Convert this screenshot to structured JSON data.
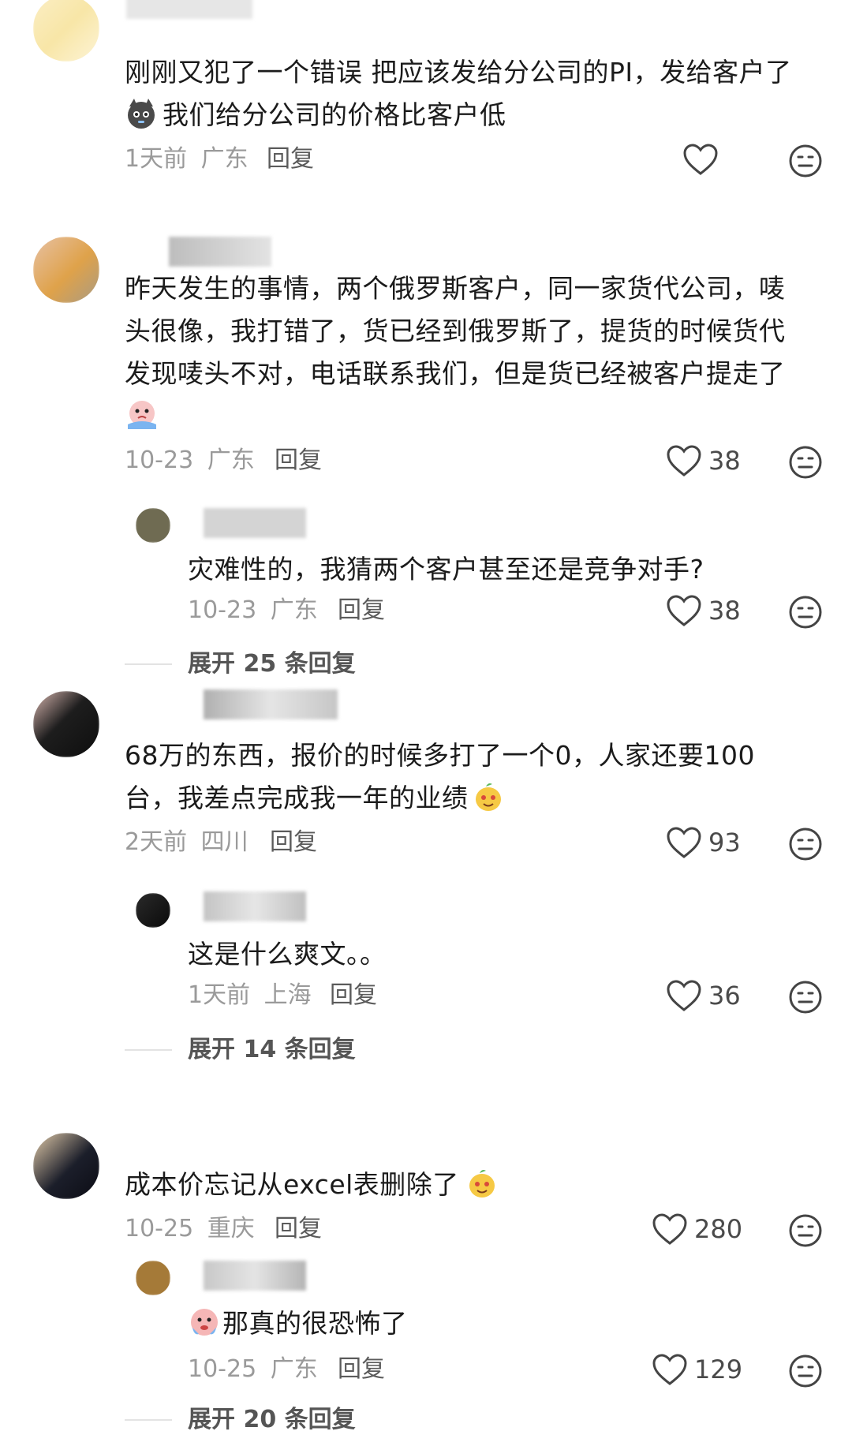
{
  "comments": [
    {
      "lines": [
        "刚刚又犯了一个错误 把应该发给分公司的PI，发给客户了",
        "我们给分公司的价格比客户低"
      ],
      "date": "1天前",
      "location": "广东",
      "reply_label": "回复",
      "likes": ""
    },
    {
      "lines": [
        "昨天发生的事情，两个俄罗斯客户，同一家货代公司，唛",
        "头很像，我打错了，货已经到俄罗斯了，提货的时候货代",
        "发现唛头不对，电话联系我们，但是货已经被客户提走了"
      ],
      "date": "10-23",
      "location": "广东",
      "reply_label": "回复",
      "likes": "38",
      "replies": [
        {
          "text": "灾难性的，我猜两个客户甚至还是竞争对手?",
          "date": "10-23",
          "location": "广东",
          "reply_label": "回复",
          "likes": "38"
        }
      ],
      "expand": "展开 25 条回复"
    },
    {
      "lines": [
        "68万的东西，报价的时候多打了一个0，人家还要100",
        "台，我差点完成我一年的业绩"
      ],
      "date": "2天前",
      "location": "四川",
      "reply_label": "回复",
      "likes": "93",
      "replies": [
        {
          "text": "这是什么爽文。。",
          "date": "1天前",
          "location": "上海",
          "reply_label": "回复",
          "likes": "36"
        }
      ],
      "expand": "展开 14 条回复"
    },
    {
      "lines": [
        "成本价忘记从excel表删除了"
      ],
      "date": "10-25",
      "location": "重庆",
      "reply_label": "回复",
      "likes": "280",
      "replies": [
        {
          "text": "那真的很恐怖了",
          "date": "10-25",
          "location": "广东",
          "reply_label": "回复",
          "likes": "129"
        }
      ],
      "expand": "展开 20 条回复"
    }
  ],
  "icons": {
    "like": "heart-outline-icon",
    "dislike": "neutral-face-icon",
    "cat_emoji": "cat-face-emoji",
    "crying_emoji": "crying-face-emoji",
    "mango_emoji": "mango-smile-emoji"
  },
  "colors": {
    "text": "#1b1b1b",
    "meta": "#9a9a9a",
    "reply": "#5b5b5b",
    "divider": "#e3e3e3"
  }
}
